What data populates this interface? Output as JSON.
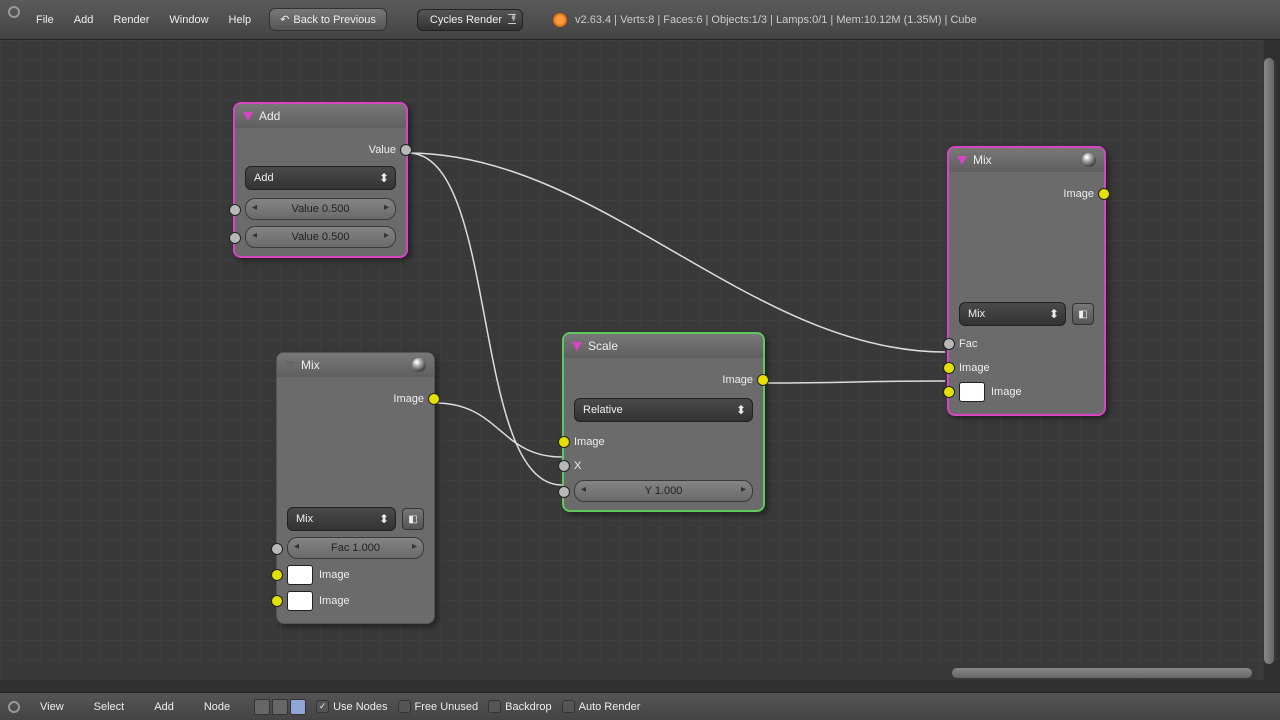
{
  "top": {
    "menus": [
      "File",
      "Add",
      "Render",
      "Window",
      "Help"
    ],
    "back_btn": "Back to Previous",
    "engine": "Cycles Render",
    "stats": "v2.63.4 | Verts:8 | Faces:6 | Objects:1/3 | Lamps:0/1 | Mem:10.12M (1.35M) | Cube"
  },
  "nodes": {
    "add": {
      "title": "Add",
      "out": "Value",
      "mode": "Add",
      "val1": "Value 0.500",
      "val2": "Value 0.500"
    },
    "mix1": {
      "title": "Mix",
      "out": "Image",
      "mode": "Mix",
      "fac": "Fac 1.000",
      "img1": "Image",
      "img2": "Image"
    },
    "scale": {
      "title": "Scale",
      "out": "Image",
      "mode": "Relative",
      "in_img": "Image",
      "in_x": "X",
      "y": "Y 1.000"
    },
    "mix2": {
      "title": "Mix",
      "out": "Image",
      "mode": "Mix",
      "fac": "Fac",
      "img1": "Image",
      "img2": "Image"
    }
  },
  "bottom": {
    "menus": [
      "View",
      "Select",
      "Add",
      "Node"
    ],
    "use_nodes": "Use Nodes",
    "free_unused": "Free Unused",
    "backdrop": "Backdrop",
    "auto_render": "Auto Render"
  }
}
